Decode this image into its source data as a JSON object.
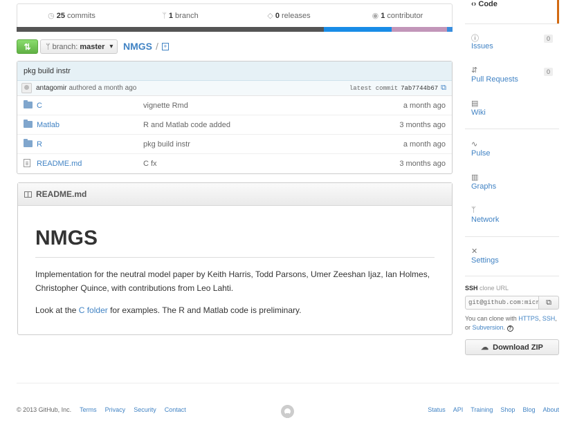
{
  "stats": {
    "commits_count": "25",
    "commits_label": "commits",
    "branch_count": "1",
    "branch_label": "branch",
    "releases_count": "0",
    "releases_label": "releases",
    "contributor_count": "1",
    "contributor_label": "contributor"
  },
  "languages": [
    {
      "color": "#555555",
      "fraction": 0.705
    },
    {
      "color": "#198ce7",
      "fraction": 0.155
    },
    {
      "color": "#c296b9",
      "fraction": 0.128
    },
    {
      "color": "#3a8ede",
      "fraction": 0.012
    }
  ],
  "branch": {
    "label": "branch:",
    "name": "master",
    "caret": "▾"
  },
  "breadcrumb": {
    "repo": "NMGS",
    "sep": "/",
    "add": "+"
  },
  "commit": {
    "message": "pkg build instr",
    "author": "antagomir",
    "authored": "authored a month ago",
    "latest_label": "latest commit",
    "sha": "7ab7744b67"
  },
  "files": [
    {
      "type": "dir",
      "name": "C",
      "message": "vignette Rmd",
      "age": "a month ago"
    },
    {
      "type": "dir",
      "name": "Matlab",
      "message": "R and Matlab code added",
      "age": "3 months ago"
    },
    {
      "type": "dir",
      "name": "R",
      "message": "pkg build instr",
      "age": "a month ago"
    },
    {
      "type": "file",
      "name": "README.md",
      "message": "C fx",
      "age": "3 months ago"
    }
  ],
  "readme": {
    "filename": "README.md",
    "title": "NMGS",
    "paragraph1": "Implementation for the neutral model paper by Keith Harris, Todd Parsons, Umer Zeeshan Ijaz, Ian Holmes, Christopher Quince, with contributions from Leo Lahti.",
    "p2_before": "Look at the ",
    "p2_link": "C folder",
    "p2_after": " for examples. The R and Matlab code is preliminary."
  },
  "nav": {
    "code": "Code",
    "issues": "Issues",
    "issues_count": "0",
    "pulls": "Pull Requests",
    "pulls_count": "0",
    "wiki": "Wiki",
    "pulse": "Pulse",
    "graphs": "Graphs",
    "network": "Network",
    "settings": "Settings"
  },
  "clone": {
    "protocol": "SSH",
    "label": "clone URL",
    "url": "git@github.com:microbiome/NMGS.git",
    "help_prefix": "You can clone with ",
    "https": "HTTPS",
    "comma": ", ",
    "ssh": "SSH",
    "or": ", or ",
    "subversion": "Subversion",
    "help_suffix": ".",
    "help_icon": "?",
    "download": "Download ZIP"
  },
  "footer": {
    "copyright": "© 2013 GitHub, Inc.",
    "left_links": [
      "Terms",
      "Privacy",
      "Security",
      "Contact"
    ],
    "right_links": [
      "Status",
      "API",
      "Training",
      "Shop",
      "Blog",
      "About"
    ]
  }
}
